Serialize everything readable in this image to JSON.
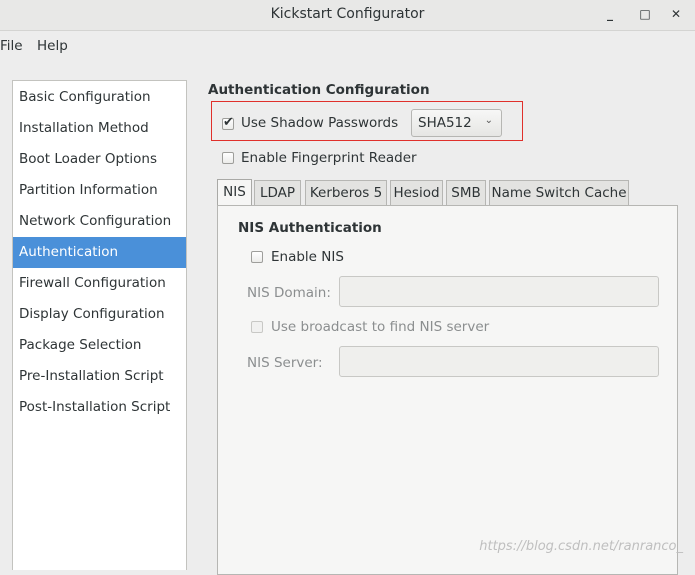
{
  "window": {
    "title": "Kickstart Configurator",
    "controls": [
      "_",
      "□",
      "✕"
    ]
  },
  "menu": {
    "items": [
      "File",
      "Help"
    ]
  },
  "sidebar": {
    "items": [
      {
        "label": "Basic Configuration"
      },
      {
        "label": "Installation Method"
      },
      {
        "label": "Boot Loader Options"
      },
      {
        "label": "Partition Information"
      },
      {
        "label": "Network Configuration"
      },
      {
        "label": "Authentication",
        "selected": true
      },
      {
        "label": "Firewall Configuration"
      },
      {
        "label": "Display Configuration"
      },
      {
        "label": "Package Selection"
      },
      {
        "label": "Pre-Installation Script"
      },
      {
        "label": "Post-Installation Script"
      }
    ]
  },
  "auth": {
    "title": "Authentication Configuration",
    "shadow_label": "Use Shadow Passwords",
    "shadow_checked": true,
    "hash_value": "SHA512",
    "fingerprint_label": "Enable Fingerprint Reader",
    "fingerprint_checked": false,
    "highlight_color": "#e0302b"
  },
  "tabs": {
    "items": [
      "NIS",
      "LDAP",
      "Kerberos 5",
      "Hesiod",
      "SMB",
      "Name Switch Cache"
    ],
    "active": "NIS"
  },
  "nis": {
    "title": "NIS Authentication",
    "enable_label": "Enable NIS",
    "domain_label": "NIS Domain:",
    "domain_value": "",
    "broadcast_label": "Use broadcast to find NIS server",
    "server_label": "NIS Server:",
    "server_value": ""
  },
  "watermark": "https://blog.csdn.net/ranranco_",
  "colors": {
    "accent": "#4a90d9",
    "window_bg": "#ededed"
  }
}
